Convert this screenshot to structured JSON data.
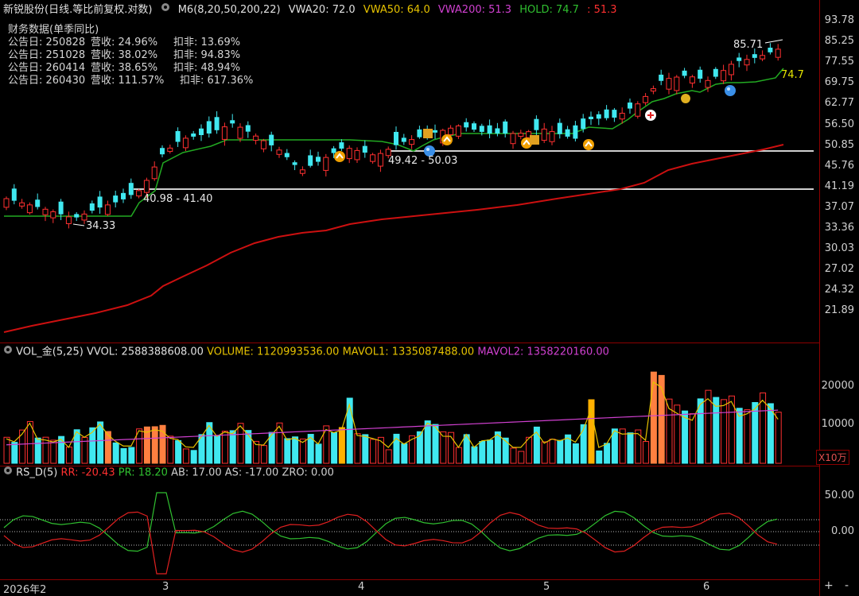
{
  "header": {
    "stock": "新锐股份(日线.等比前复权.对数)",
    "m6": "M6(8,20,50,200,22)",
    "vwa20": "VWA20: 72.0",
    "vwa50": "VWA50: 64.0",
    "vwa200": "VWA200: 51.3",
    "hold": "HOLD: 74.7",
    "hold2": ": 51.3"
  },
  "financials": {
    "title": "财务数据(单季同比)",
    "rows": [
      {
        "date": "公告日: 250828",
        "rev": "营收:  24.96%",
        "np": "扣非:  13.69%"
      },
      {
        "date": "公告日: 251028",
        "rev": "营收:  38.02%",
        "np": "扣非:  94.83%"
      },
      {
        "date": "公告日: 260414",
        "rev": "营收:  38.65%",
        "np": "扣非:  48.94%"
      },
      {
        "date": "公告日: 260430",
        "rev": "营收:  111.57%",
        "np": "扣非:  617.36%"
      }
    ]
  },
  "price_axis": [
    "93.78",
    "85.25",
    "77.55",
    "69.75",
    "62.77",
    "56.50",
    "50.85",
    "45.76",
    "41.19",
    "37.07",
    "33.36",
    "30.03",
    "27.02",
    "24.32",
    "21.89"
  ],
  "annotations": {
    "low": "34.33",
    "range1": "40.98 - 41.40",
    "range2": "49.42 - 50.03",
    "high": "85.71",
    "hold_label": "74.7"
  },
  "volume": {
    "title": "VOL_金(5,25)",
    "vvol": "VVOL: 2588388608.00",
    "volume": "VOLUME: 1120993536.00",
    "mavol1": "MAVOL1: 1335087488.00",
    "mavol2": "MAVOL2: 1358220160.00",
    "axis": [
      "20000",
      "10000"
    ],
    "unit": "X10万"
  },
  "rsd": {
    "title": "RS_D(5)",
    "rr": "RR: -20.43",
    "pr": "PR: 18.20",
    "ab": "AB: 17.00",
    "as": "AS: -17.00",
    "zro": "ZRO: 0.00",
    "axis": [
      "50.00",
      "0.00"
    ]
  },
  "x_axis": [
    "2026年2",
    "3",
    "4",
    "5",
    "6"
  ],
  "controls": {
    "plus": "+",
    "minus": "-"
  },
  "colors": {
    "up": "#ff3030",
    "down": "#40e8f0",
    "ma": "#cc1010",
    "hold": "#22aa22",
    "vwa50": "#e6c200",
    "vwa200": "#d040d0"
  },
  "chart_data": {
    "type": "candlestick",
    "price_scale": "log",
    "ylim": [
      21.0,
      95.0
    ],
    "x_ticks": [
      "2026年2",
      "3",
      "4",
      "5",
      "6"
    ],
    "candles": [],
    "ma_line_start": 21.0,
    "ma_line_end": 51.0,
    "support_lines": [
      41.19,
      49.7
    ]
  }
}
